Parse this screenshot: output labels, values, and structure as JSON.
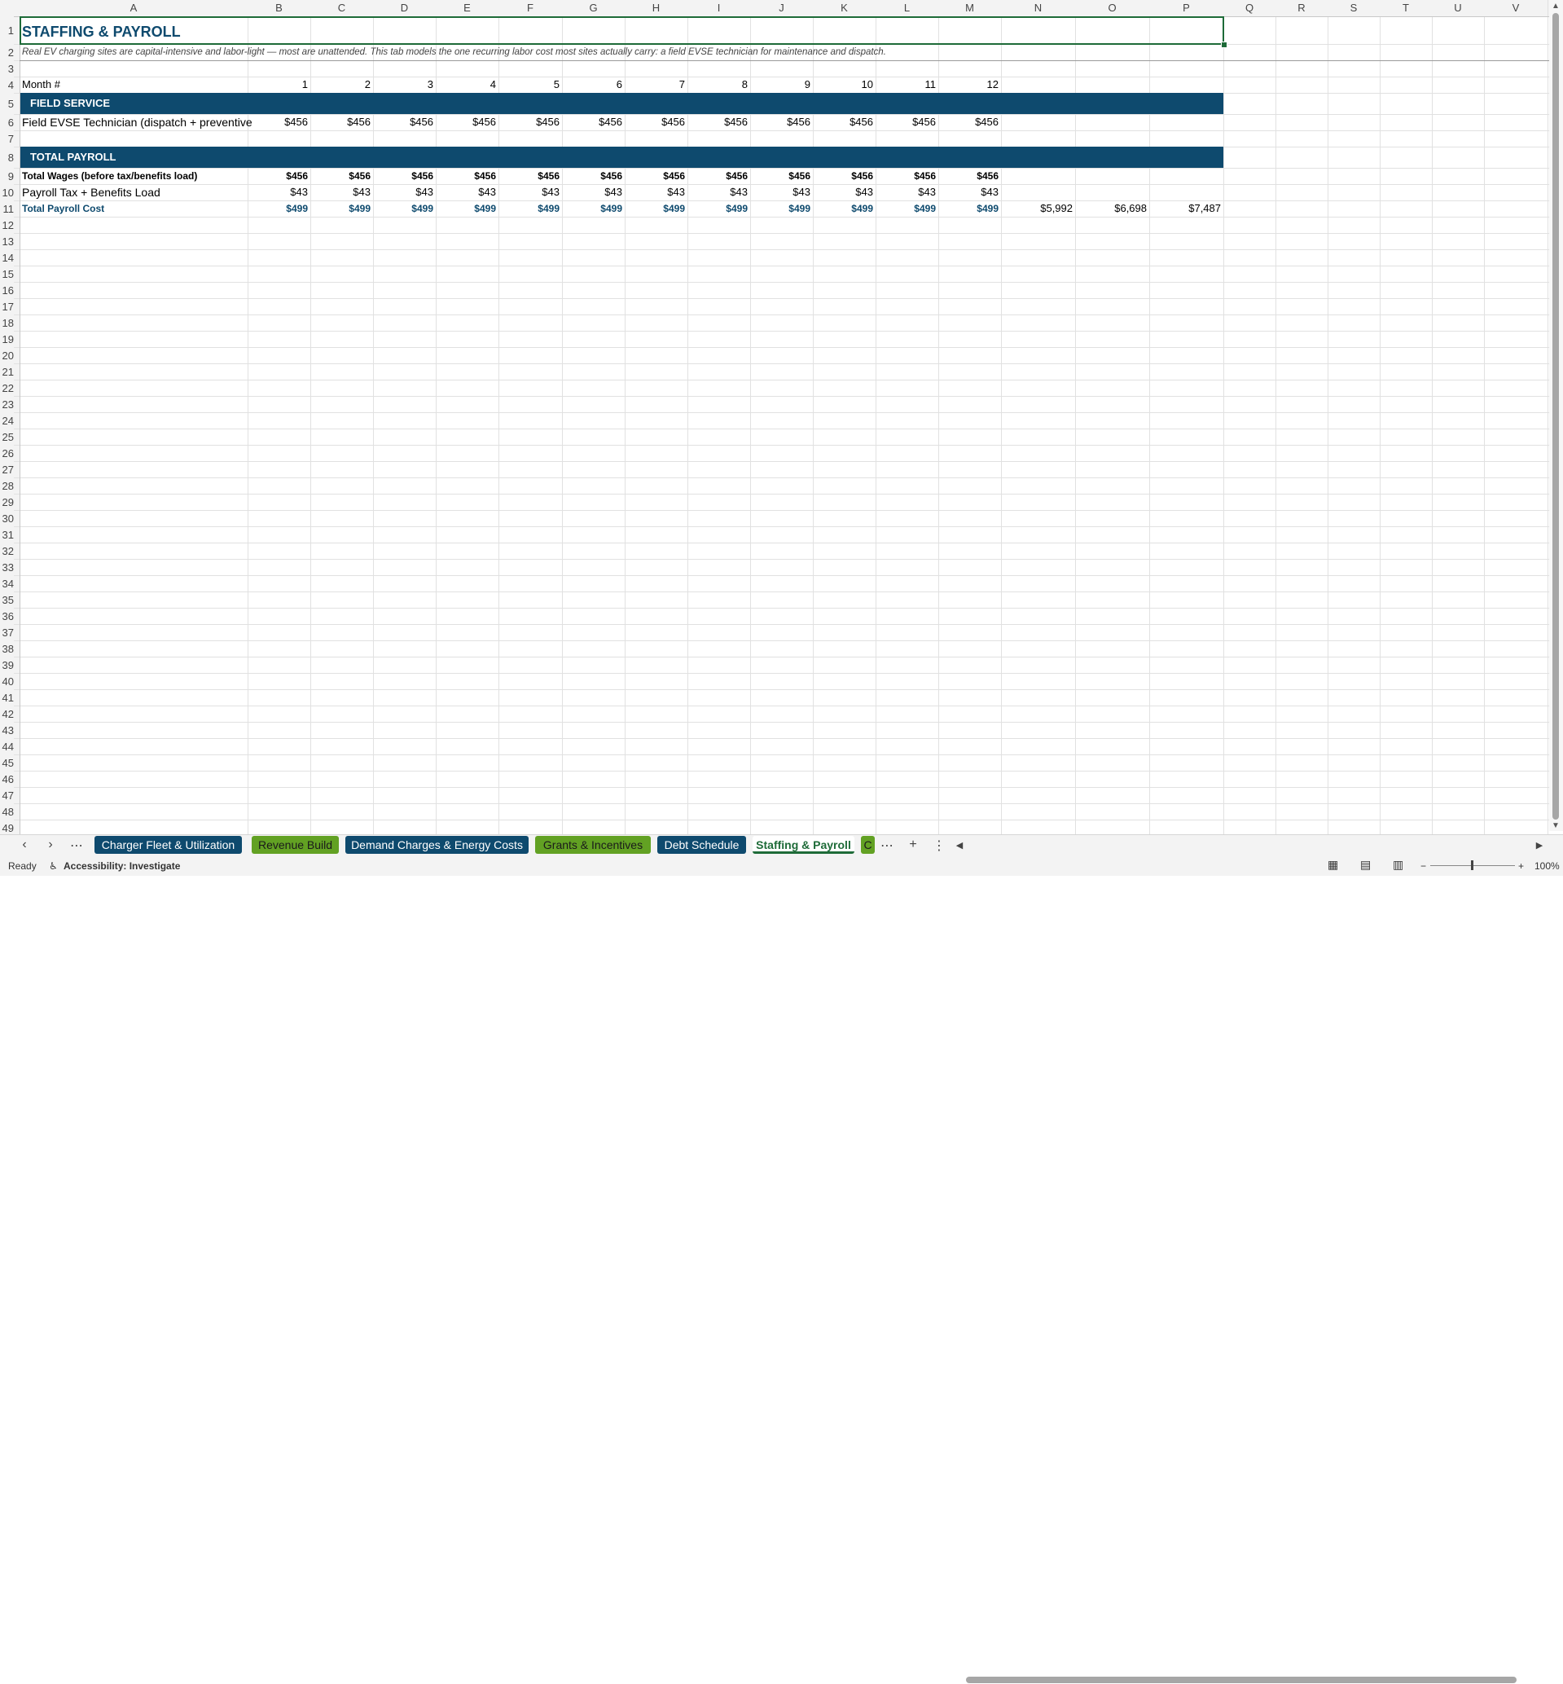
{
  "sheet": {
    "columns": [
      "A",
      "B",
      "C",
      "D",
      "E",
      "F",
      "G",
      "H",
      "I",
      "J",
      "K",
      "L",
      "M",
      "N",
      "O",
      "P",
      "Q",
      "R",
      "S",
      "T",
      "U",
      "V"
    ],
    "title": "STAFFING & PAYROLL",
    "subtitle": "Real EV charging sites are capital-intensive and labor-light — most are unattended. This tab models the one recurring labor cost most sites actually carry: a field EVSE technician for maintenance and dispatch.",
    "month_label": "Month #",
    "months": [
      "1",
      "2",
      "3",
      "4",
      "5",
      "6",
      "7",
      "8",
      "9",
      "10",
      "11",
      "12"
    ],
    "section_field": "FIELD SERVICE",
    "tech_label": "Field EVSE Technician (dispatch + preventive",
    "tech_values": [
      "$456",
      "$456",
      "$456",
      "$456",
      "$456",
      "$456",
      "$456",
      "$456",
      "$456",
      "$456",
      "$456",
      "$456"
    ],
    "section_total": "TOTAL PAYROLL",
    "wages_label": "Total Wages (before tax/benefits load)",
    "wages_values": [
      "$456",
      "$456",
      "$456",
      "$456",
      "$456",
      "$456",
      "$456",
      "$456",
      "$456",
      "$456",
      "$456",
      "$456"
    ],
    "tax_label": "Payroll Tax + Benefits Load",
    "tax_values": [
      "$43",
      "$43",
      "$43",
      "$43",
      "$43",
      "$43",
      "$43",
      "$43",
      "$43",
      "$43",
      "$43",
      "$43"
    ],
    "total_label": "Total Payroll Cost",
    "total_values": [
      "$499",
      "$499",
      "$499",
      "$499",
      "$499",
      "$499",
      "$499",
      "$499",
      "$499",
      "$499",
      "$499",
      "$499",
      "$5,992",
      "$6,698",
      "$7,487"
    ]
  },
  "tabs": [
    {
      "label": "Charger Fleet & Utilization",
      "style": "blue"
    },
    {
      "label": "Revenue Build",
      "style": "green"
    },
    {
      "label": "Demand Charges & Energy Costs",
      "style": "blue"
    },
    {
      "label": "Grants & Incentives",
      "style": "green"
    },
    {
      "label": "Debt Schedule",
      "style": "blue"
    },
    {
      "label": "Staffing & Payroll",
      "style": "active"
    },
    {
      "label": "C",
      "style": "green"
    }
  ],
  "status": {
    "ready": "Ready",
    "accessibility": "Accessibility: Investigate",
    "zoom": "100%"
  },
  "colors": {
    "band": "#0e4a6e",
    "total_text": "#0e4a6e",
    "green_tab": "#62a123",
    "selection": "#1e6b38"
  }
}
